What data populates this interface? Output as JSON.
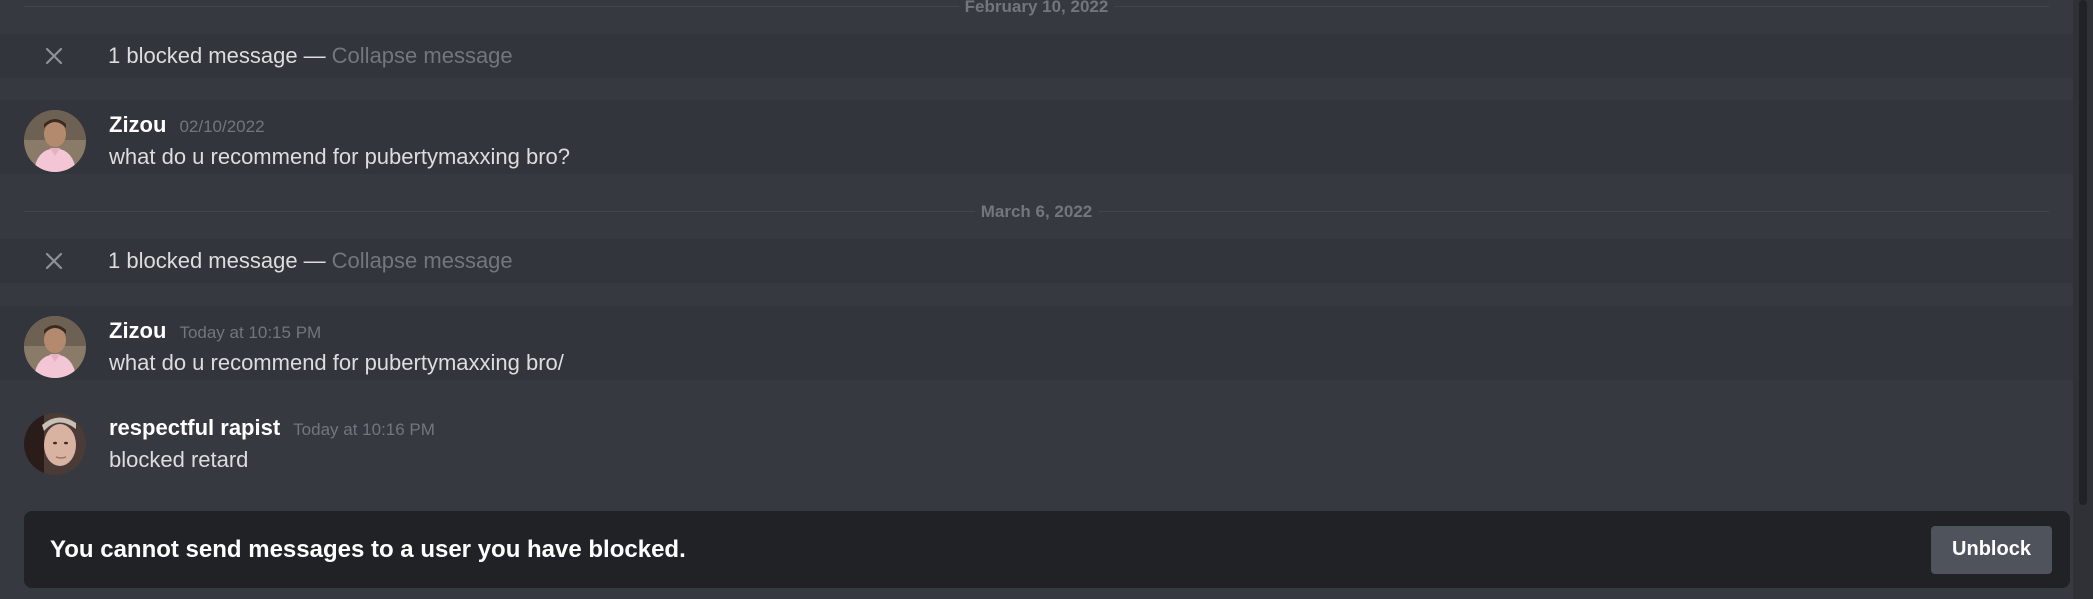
{
  "dividers": [
    {
      "label": "February 10, 2022"
    },
    {
      "label": "March 6, 2022"
    }
  ],
  "blocked_notices": [
    {
      "text": "1 blocked message —",
      "collapse": "Collapse message"
    },
    {
      "text": "1 blocked message —",
      "collapse": "Collapse message"
    }
  ],
  "messages": [
    {
      "username": "Zizou",
      "timestamp": "02/10/2022",
      "content": "what do u recommend for pubertymaxxing bro?"
    },
    {
      "username": "Zizou",
      "timestamp": "Today at 10:15 PM",
      "content": "what do u recommend for pubertymaxxing bro/"
    },
    {
      "username": "respectful rapist",
      "timestamp": "Today at 10:16 PM",
      "content": "blocked retard"
    }
  ],
  "blocked_bar": {
    "notice": "You cannot send messages to a user you have blocked.",
    "unblock_label": "Unblock"
  },
  "icons": {
    "close": "close-icon",
    "avatar_zizou": "avatar-zizou",
    "avatar_respectful": "avatar-respectful-rapist"
  },
  "colors": {
    "background": "#36393f",
    "blocked_background": "#32353b",
    "bar_background": "#202225",
    "muted_text": "#72767d",
    "button": "#4f545c"
  }
}
